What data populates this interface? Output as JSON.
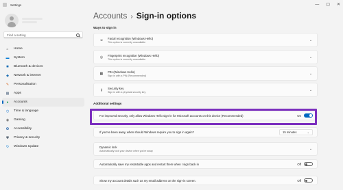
{
  "window": {
    "title": "Settings",
    "controls": [
      "—",
      "▢",
      "✕"
    ]
  },
  "search": {
    "placeholder": "Find a setting"
  },
  "nav": [
    {
      "label": "Home",
      "icon": "home-icon",
      "color": "#5b5b5b",
      "glyph": "⌂",
      "active": false
    },
    {
      "label": "System",
      "icon": "monitor-icon",
      "color": "#0078d4",
      "glyph": "▬",
      "active": false
    },
    {
      "label": "Bluetooth & devices",
      "icon": "bluetooth-icon",
      "color": "#0063b1",
      "glyph": "✱",
      "active": false
    },
    {
      "label": "Network & internet",
      "icon": "wifi-icon",
      "color": "#1e6fb4",
      "glyph": "◆",
      "active": false
    },
    {
      "label": "Personalisation",
      "icon": "brush-icon",
      "color": "#d86b27",
      "glyph": "✎",
      "active": false
    },
    {
      "label": "Apps",
      "icon": "apps-icon",
      "color": "#5a6f87",
      "glyph": "▦",
      "active": false
    },
    {
      "label": "Accounts",
      "icon": "person-icon",
      "color": "#2aa05a",
      "glyph": "●",
      "active": true
    },
    {
      "label": "Time & language",
      "icon": "globe-clock-icon",
      "color": "#1f7ad1",
      "glyph": "◷",
      "active": false
    },
    {
      "label": "Gaming",
      "icon": "gamepad-icon",
      "color": "#6b6b6b",
      "glyph": "◉",
      "active": false
    },
    {
      "label": "Accessibility",
      "icon": "accessibility-icon",
      "color": "#1b5fa8",
      "glyph": "✪",
      "active": false
    },
    {
      "label": "Privacy & security",
      "icon": "shield-icon",
      "color": "#5f6b78",
      "glyph": "⛊",
      "active": false
    },
    {
      "label": "Windows Update",
      "icon": "update-icon",
      "color": "#0078d4",
      "glyph": "↻",
      "active": false
    }
  ],
  "breadcrumb": {
    "parent": "Accounts",
    "separator": "›",
    "current": "Sign-in options"
  },
  "ways": {
    "heading": "Ways to sign in",
    "items": [
      {
        "title": "Facial recognition (Windows Hello)",
        "subtitle": "This option is currently unavailable",
        "icon": "face-icon",
        "glyph": "☺"
      },
      {
        "title": "Fingerprint recognition (Windows Hello)",
        "subtitle": "This option is currently unavailable",
        "icon": "fingerprint-icon",
        "glyph": "◎"
      },
      {
        "title": "PIN (Windows Hello)",
        "subtitle": "Sign in with a PIN (Recommended)",
        "icon": "pin-icon",
        "glyph": "▦"
      },
      {
        "title": "Security key",
        "subtitle": "Sign in with a physical security key",
        "icon": "key-icon",
        "glyph": "⚷"
      }
    ]
  },
  "additional": {
    "heading": "Additional settings",
    "hello_only": {
      "text": "For improved security, only allow Windows Hello sign-in for Microsoft accounts on this device (Recommended)",
      "state": "On"
    },
    "away": {
      "text": "If you've been away, when should Windows require you to sign in again?",
      "value": "15 minutes"
    },
    "dynamic_lock": {
      "title": "Dynamic lock",
      "subtitle": "Automatically lock your device when you're away"
    },
    "restartable_apps": {
      "text": "Automatically save my restartable apps and restart them when I sign back in",
      "state": "Off"
    },
    "show_details": {
      "text": "Show my account details such as my email address on the sign-in screen.",
      "state": "Off"
    }
  },
  "colors": {
    "accent": "#0067c0",
    "highlight_border": "#7b2fbe"
  }
}
